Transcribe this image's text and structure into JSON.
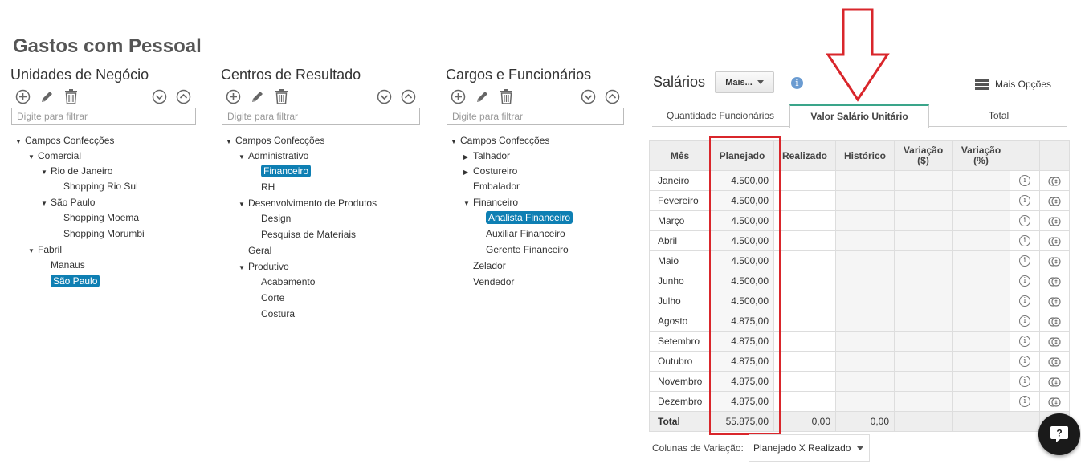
{
  "page": {
    "title": "Gastos com Pessoal"
  },
  "unidades": {
    "title": "Unidades de Negócio",
    "filter_placeholder": "Digite para filtrar",
    "nodes": [
      {
        "label": "Campos Confecções",
        "expanded": true
      },
      {
        "label": "Comercial",
        "expanded": true
      },
      {
        "label": "Rio de Janeiro",
        "expanded": true
      },
      {
        "label": "Shopping Rio Sul"
      },
      {
        "label": "São Paulo",
        "expanded": true
      },
      {
        "label": "Shopping Moema"
      },
      {
        "label": "Shopping Morumbi"
      },
      {
        "label": "Fabril",
        "expanded": true
      },
      {
        "label": "Manaus"
      },
      {
        "label": "São Paulo",
        "selected": true
      }
    ]
  },
  "centros": {
    "title": "Centros de Resultado",
    "filter_placeholder": "Digite para filtrar",
    "nodes": [
      {
        "label": "Campos Confecções",
        "expanded": true
      },
      {
        "label": "Administrativo",
        "expanded": true
      },
      {
        "label": "Financeiro",
        "selected": true
      },
      {
        "label": "RH"
      },
      {
        "label": "Desenvolvimento de Produtos",
        "expanded": true
      },
      {
        "label": "Design"
      },
      {
        "label": "Pesquisa de Materiais"
      },
      {
        "label": "Geral"
      },
      {
        "label": "Produtivo",
        "expanded": true
      },
      {
        "label": "Acabamento"
      },
      {
        "label": "Corte"
      },
      {
        "label": "Costura"
      }
    ]
  },
  "cargos": {
    "title": "Cargos e Funcionários",
    "filter_placeholder": "Digite para filtrar",
    "nodes": [
      {
        "label": "Campos Confecções",
        "expanded": true
      },
      {
        "label": "Talhador",
        "expanded": false
      },
      {
        "label": "Costureiro",
        "expanded": false
      },
      {
        "label": "Embalador"
      },
      {
        "label": "Financeiro",
        "expanded": true
      },
      {
        "label": "Analista Financeiro",
        "selected": true
      },
      {
        "label": "Auxiliar Financeiro"
      },
      {
        "label": "Gerente Financeiro"
      },
      {
        "label": "Zelador"
      },
      {
        "label": "Vendedor"
      }
    ]
  },
  "salarios": {
    "title": "Salários",
    "mais_label": "Mais...",
    "mais_opcoes_label": "Mais Opções",
    "tabs": [
      {
        "label": "Quantidade Funcionários",
        "active": false
      },
      {
        "label": "Valor Salário Unitário",
        "active": true
      },
      {
        "label": "Total",
        "active": false
      }
    ],
    "columns": {
      "mes": "Mês",
      "planejado": "Planejado",
      "realizado": "Realizado",
      "historico": "Histórico",
      "var_abs_1": "Variação",
      "var_abs_2": "($)",
      "var_pct_1": "Variação",
      "var_pct_2": "(%)"
    },
    "rows": [
      {
        "mes": "Janeiro",
        "planejado": "4.500,00"
      },
      {
        "mes": "Fevereiro",
        "planejado": "4.500,00"
      },
      {
        "mes": "Março",
        "planejado": "4.500,00"
      },
      {
        "mes": "Abril",
        "planejado": "4.500,00"
      },
      {
        "mes": "Maio",
        "planejado": "4.500,00"
      },
      {
        "mes": "Junho",
        "planejado": "4.500,00"
      },
      {
        "mes": "Julho",
        "planejado": "4.500,00"
      },
      {
        "mes": "Agosto",
        "planejado": "4.875,00"
      },
      {
        "mes": "Setembro",
        "planejado": "4.875,00"
      },
      {
        "mes": "Outubro",
        "planejado": "4.875,00"
      },
      {
        "mes": "Novembro",
        "planejado": "4.875,00"
      },
      {
        "mes": "Dezembro",
        "planejado": "4.875,00"
      }
    ],
    "total": {
      "mes": "Total",
      "planejado": "55.875,00",
      "realizado": "0,00",
      "historico": "0,00"
    },
    "variation_label": "Colunas de Variação:",
    "variation_value": "Planejado X Realizado"
  },
  "icons": {
    "add": "add-circle-icon",
    "edit": "pencil-icon",
    "delete": "trash-icon",
    "expand_all": "chevron-down-circle-icon",
    "collapse_all": "chevron-up-circle-icon",
    "info": "info-icon",
    "coins": "coins-icon",
    "help": "help-chat-icon"
  },
  "colors": {
    "selected_bg": "#0e7fb3",
    "active_tab_accent": "#3aa58a",
    "annotation_red": "#d9262b"
  }
}
